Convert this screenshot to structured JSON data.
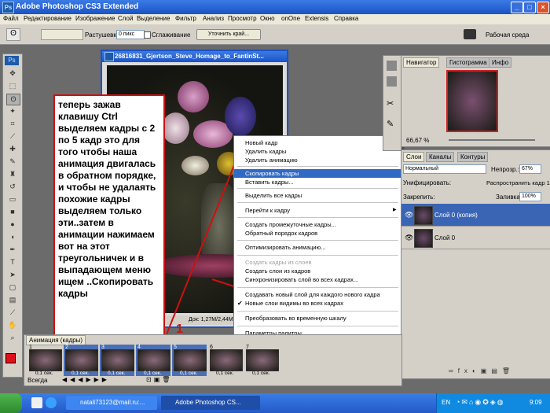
{
  "window": {
    "title": "Adobe Photoshop CS3 Extended",
    "app_badge": "Ps"
  },
  "menu": [
    "Файл",
    "Редактирование",
    "Изображение",
    "Слой",
    "Выделение",
    "Фильтр",
    "Анализ",
    "Просмотр",
    "Окно",
    "onOne",
    "Extensis",
    "Справка"
  ],
  "options": {
    "feather_label": "Растушевка:",
    "feather_value": "0 пикс",
    "antialias_label": "Сглаживание",
    "refine_button": "Уточнить край...",
    "workspace_label": "Рабочая среда"
  },
  "document": {
    "title": "26816831_Gjertson_Steve_Homage_to_FantinSt...",
    "status": "Док: 1,27M/2,44M"
  },
  "annotation": {
    "text": "теперь зажав клавишу Ctrl выделяем кадры с 2 по 5 кадр это для того чтобы наша анимация двигалась в обратном порядке, и чтобы не удалаять похожие кадры выделяем только эти..затем в анимации нажимаем вот на этот треугольничек и в выпадающем меню ищем ..Скопировать кадры",
    "num1": "1",
    "num2": "2"
  },
  "context_menu": {
    "items": [
      {
        "label": "Новый кадр",
        "disabled": false
      },
      {
        "label": "Удалить кадры",
        "disabled": false
      },
      {
        "label": "Удалить анимацию",
        "disabled": false
      },
      {
        "label": "Скопировать кадры",
        "disabled": false,
        "selected": true
      },
      {
        "label": "Вставить кадры...",
        "disabled": false
      },
      {
        "label": "Выделить все кадры",
        "disabled": false
      },
      {
        "label": "Перейти к кадру",
        "disabled": false
      },
      {
        "label": "Создать промежуточные кадры...",
        "disabled": false
      },
      {
        "label": "Обратный порядок кадров",
        "disabled": false
      },
      {
        "label": "Оптимизировать анимацию...",
        "disabled": false
      },
      {
        "label": "Создать кадры из слоев",
        "disabled": true
      },
      {
        "label": "Создать слои из кадров",
        "disabled": false
      },
      {
        "label": "Синхронизировать слой во всех кадрах...",
        "disabled": false
      },
      {
        "label": "Создавать новый слой для каждого нового кадра",
        "disabled": false
      },
      {
        "label": "Новые слои видимы во всех кадрах",
        "disabled": false,
        "checked": true
      },
      {
        "label": "Преобразовать во временную шкалу",
        "disabled": false
      },
      {
        "label": "Параметры палитры...",
        "disabled": false
      }
    ],
    "arrow": "▶",
    "check": "✔"
  },
  "navigator": {
    "tabs": [
      "Навигатор",
      "Гистограмма",
      "Инфо"
    ],
    "zoom": "66,67 %"
  },
  "layers_panel": {
    "tabs": [
      "Слои",
      "Каналы",
      "Контуры"
    ],
    "blend_mode": "Нормальный",
    "opacity_label": "Непрозр.:",
    "opacity_value": "67%",
    "unify_label": "Унифицировать:",
    "propagate_label": "Распространить кадр 1",
    "lock_label": "Закрепить:",
    "fill_label": "Заливка:",
    "fill_value": "100%",
    "layers": [
      {
        "name": "Слой 0 (копия)",
        "selected": true
      },
      {
        "name": "Слой 0",
        "selected": false
      }
    ]
  },
  "animation": {
    "tab": "Анимация (кадры)",
    "frames": [
      {
        "num": "1",
        "delay": "0,1 сек.",
        "selected": false
      },
      {
        "num": "2",
        "delay": "0,1 сек.",
        "selected": true
      },
      {
        "num": "3",
        "delay": "0,1 сек.",
        "selected": true
      },
      {
        "num": "4",
        "delay": "0,1 сек.",
        "selected": true
      },
      {
        "num": "5",
        "delay": "0,1 сек.",
        "selected": true
      },
      {
        "num": "6",
        "delay": "0,1 сек.",
        "selected": false
      },
      {
        "num": "7",
        "delay": "0,1 сек.",
        "selected": false
      }
    ],
    "loop": "Всегда"
  },
  "taskbar": {
    "mail_task": "natali73123@mail.ru:...",
    "ps_task": "Adobe Photoshop CS...",
    "lang": "EN",
    "clock": "9:09"
  },
  "colors": {
    "accent": "#316ac5",
    "annotation": "#cc1111",
    "foreground": "#e0101a"
  }
}
